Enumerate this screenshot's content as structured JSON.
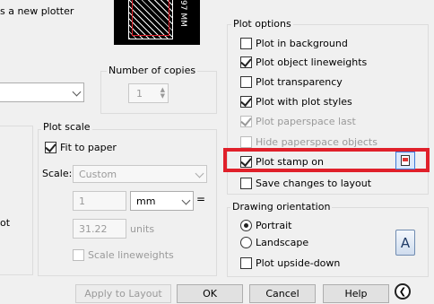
{
  "header": {
    "new_plotter_text": "s a new plotter",
    "preview_dim": "97 MM"
  },
  "copies": {
    "label": "Number of copies",
    "value": "1"
  },
  "plot_scale": {
    "label": "Plot scale",
    "fit_to_paper": "Fit to paper",
    "scale_label": "Scale:",
    "scale_value": "Custom",
    "value1": "1",
    "unit1": "mm",
    "value2": "31.22",
    "unit2": "units",
    "scale_lineweights": "Scale lineweights"
  },
  "plot_options": {
    "label": "Plot options",
    "items": [
      {
        "label": "Plot in background"
      },
      {
        "label": "Plot object lineweights"
      },
      {
        "label": "Plot transparency"
      },
      {
        "label": "Plot with plot styles"
      },
      {
        "label": "Plot paperspace last"
      },
      {
        "label": "Hide paperspace objects"
      },
      {
        "label": "Plot stamp on"
      },
      {
        "label": "Save changes to layout"
      }
    ]
  },
  "orientation": {
    "label": "Drawing orientation",
    "portrait": "Portrait",
    "landscape": "Landscape",
    "upside_down": "Plot upside-down",
    "icon_letter": "A"
  },
  "left_edge_text": "ot",
  "footer": {
    "apply": "Apply to Layout",
    "ok": "OK",
    "cancel": "Cancel",
    "help": "Help"
  },
  "colors": {
    "highlight": "#e0202a",
    "preview_bg": "#000000"
  }
}
